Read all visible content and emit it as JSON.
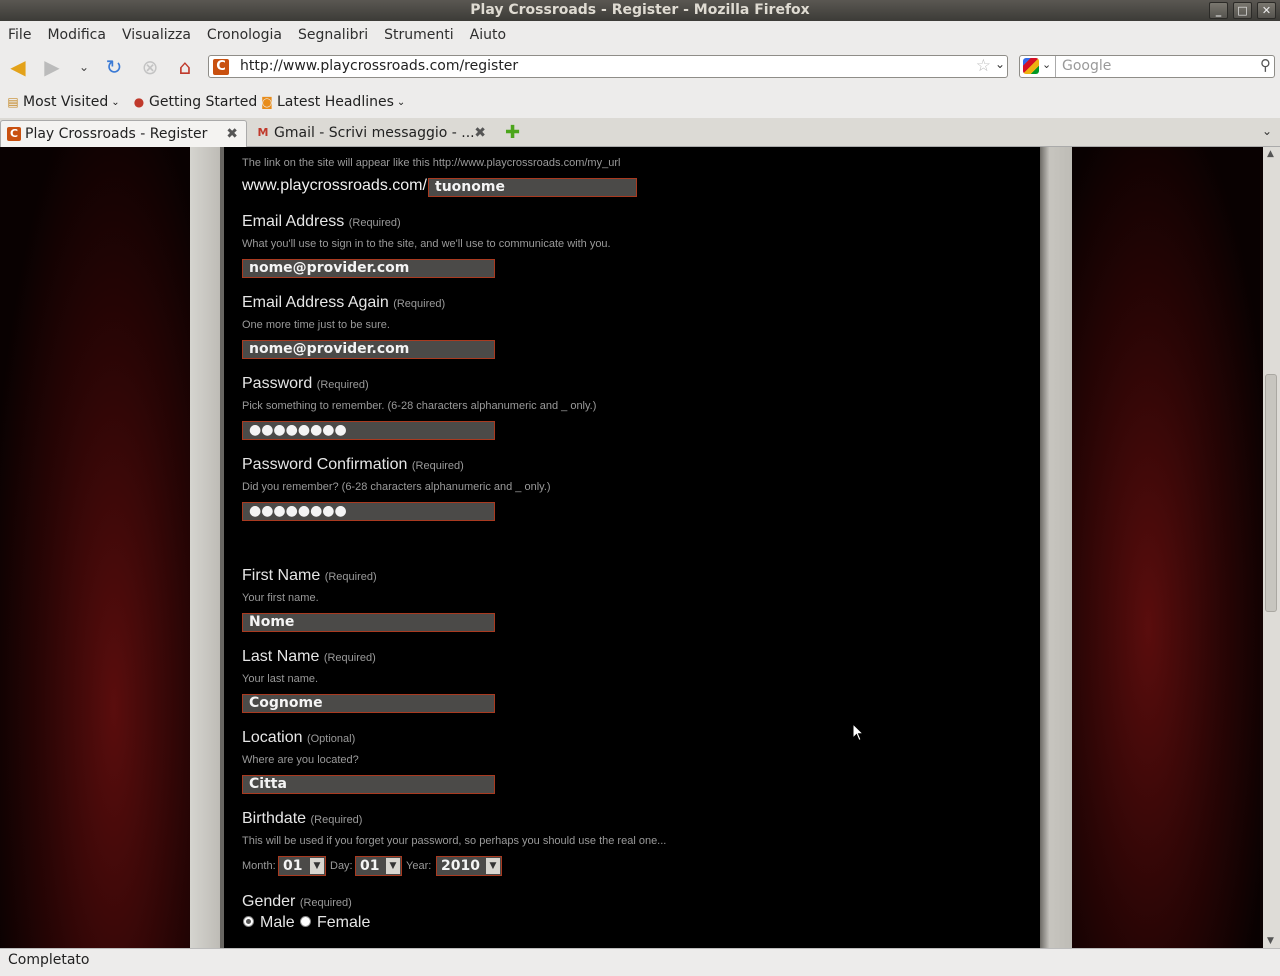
{
  "window": {
    "title": "Play Crossroads - Register - Mozilla Firefox"
  },
  "menu": [
    "File",
    "Modifica",
    "Visualizza",
    "Cronologia",
    "Segnalibri",
    "Strumenti",
    "Aiuto"
  ],
  "nav": {
    "url": "http://www.playcrossroads.com/register",
    "search_placeholder": "Google"
  },
  "bookmarks": [
    {
      "label": "Most Visited",
      "icon": "most-visited-icon"
    },
    {
      "label": "Getting Started",
      "icon": "firefox-icon"
    },
    {
      "label": "Latest Headlines",
      "icon": "rss-icon"
    }
  ],
  "tabs": [
    {
      "label": "Play Crossroads - Register",
      "active": true
    },
    {
      "label": "Gmail - Scrivi messaggio - ...",
      "active": false
    }
  ],
  "form": {
    "url_hint": "The link on the site will appear like this http://www.playcrossroads.com/my_url",
    "url_prefix": "www.playcrossroads.com/",
    "url_value": "tuonome",
    "email": {
      "label": "Email Address",
      "req": "(Required)",
      "hint": "What you'll use to sign in to the site, and we'll use to communicate with you.",
      "value": "nome@provider.com"
    },
    "email_again": {
      "label": "Email Address Again",
      "req": "(Required)",
      "hint": "One more time just to be sure.",
      "value": "nome@provider.com"
    },
    "password": {
      "label": "Password",
      "req": "(Required)",
      "hint": "Pick something to remember. (6-28 characters alphanumeric and _ only.)",
      "value": "●●●●●●●●"
    },
    "password_confirm": {
      "label": "Password Confirmation",
      "req": "(Required)",
      "hint": "Did you remember? (6-28 characters alphanumeric and _ only.)",
      "value": "●●●●●●●●"
    },
    "first_name": {
      "label": "First Name",
      "req": "(Required)",
      "hint": "Your first name.",
      "value": "Nome"
    },
    "last_name": {
      "label": "Last Name",
      "req": "(Required)",
      "hint": "Your last name.",
      "value": "Cognome"
    },
    "location": {
      "label": "Location",
      "req": "(Optional)",
      "hint": "Where are you located?",
      "value": "Citta"
    },
    "birthdate": {
      "label": "Birthdate",
      "req": "(Required)",
      "hint": "This will be used if you forget your password, so perhaps you should use the real one...",
      "month_label": "Month:",
      "month": "01",
      "day_label": "Day:",
      "day": "01",
      "year_label": "Year:",
      "year": "2010"
    },
    "gender": {
      "label": "Gender",
      "req": "(Required)",
      "male": "Male",
      "female": "Female",
      "selected": "Male"
    }
  },
  "status": "Completato"
}
